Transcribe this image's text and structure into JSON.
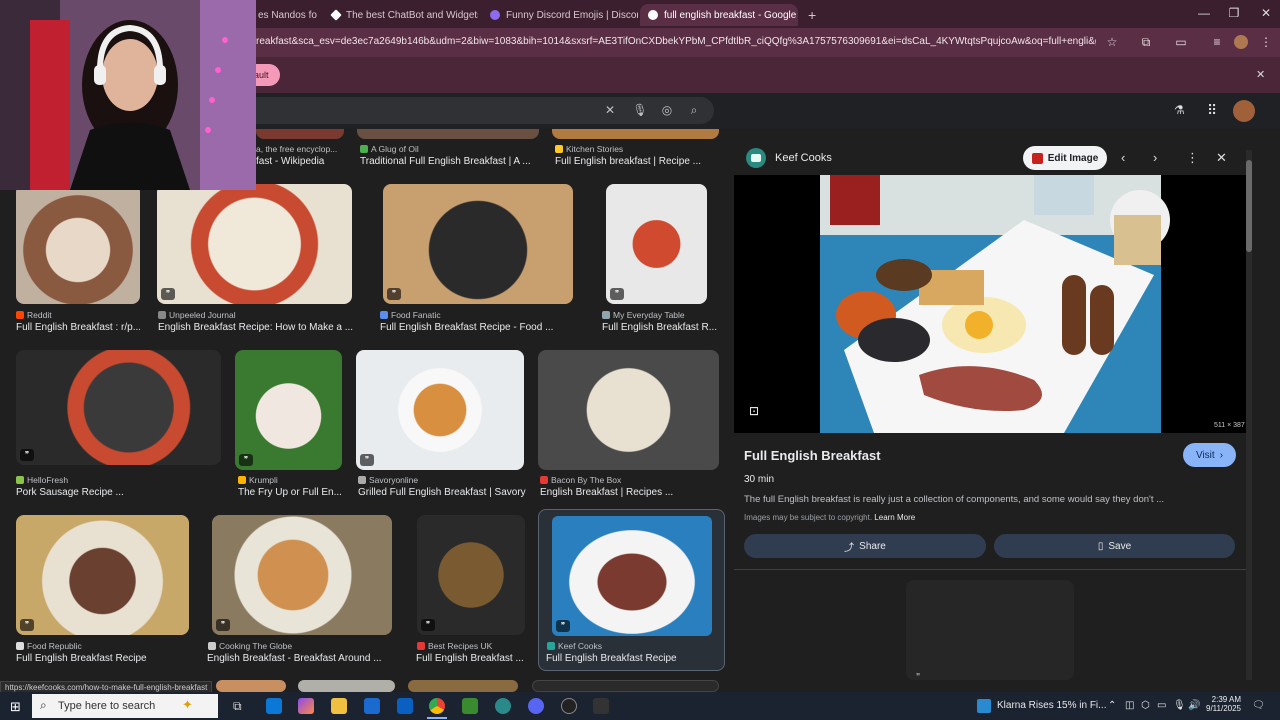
{
  "tabs": [
    {
      "label": "es Nandos fo",
      "color": "#e07a3a"
    },
    {
      "label": "The best ChatBot and Widgets",
      "color": "#ffffff"
    },
    {
      "label": "Funny Discord Emojis | Discord",
      "color": "#8b6cf0"
    },
    {
      "label": "full english breakfast - Google S",
      "color": "#ffffff"
    }
  ],
  "new_tab": "+",
  "address_url": "reakfast&sca_esv=de3ec7a2649b146b&udm=2&biw=1083&bih=1014&sxsrf=AE3TifOnCXDbekYPbM_CPfdtlbR_ciQQfg%3A1757576309691&ei=dsCaL_4KYWtqtsPqujcoAw&oq=full+engli&gs_lp=EgNp...",
  "default_chip": "ault",
  "status_url": "https://keefcooks.com/how-to-make-full-english-breakfast",
  "grid": {
    "row0": [
      {
        "source": "a, the free encyclop...",
        "title": "fast - Wikipedia",
        "color": "#4a90e2"
      },
      {
        "source": "A Glug of Oil",
        "title": "Traditional Full English Breakfast | A ...",
        "color": "#4caf50"
      },
      {
        "source": "Kitchen Stories",
        "title": "Full English breakfast | Recipe ...",
        "color": "#ffca28"
      }
    ],
    "row1": [
      {
        "source": "Reddit",
        "title": "Full English Breakfast : r/p...",
        "color": "#ff4500"
      },
      {
        "source": "Unpeeled Journal",
        "title": "English Breakfast Recipe: How to Make a ...",
        "color": "#888888"
      },
      {
        "source": "Food Fanatic",
        "title": "Full English Breakfast Recipe - Food ...",
        "color": "#5b8def"
      },
      {
        "source": "My Everyday Table",
        "title": "Full English Breakfast R...",
        "color": "#90a4ae"
      }
    ],
    "row2": [
      {
        "source": "HelloFresh",
        "title": "Pork Sausage Recipe ...",
        "color": "#8bc34a"
      },
      {
        "source": "Krumpli",
        "title": "The Fry Up or Full En...",
        "color": "#ffb300"
      },
      {
        "source": "Savoryonline",
        "title": "Grilled Full English Breakfast | Savory",
        "color": "#aaaaaa"
      },
      {
        "source": "Bacon By The Box",
        "title": "English Breakfast | Recipes ...",
        "color": "#e53935"
      }
    ],
    "row3": [
      {
        "source": "Food Republic",
        "title": "Full English Breakfast Recipe",
        "color": "#dddddd"
      },
      {
        "source": "Cooking The Globe",
        "title": "English Breakfast - Breakfast Around ...",
        "color": "#cccccc"
      },
      {
        "source": "Best Recipes UK",
        "title": "Full English Breakfast ...",
        "color": "#e53935"
      },
      {
        "source": "Keef Cooks",
        "title": "Full English Breakfast Recipe",
        "color": "#26a69a"
      }
    ]
  },
  "panel": {
    "site": "Keef Cooks",
    "edit_image": "Edit Image",
    "dimensions": "511 × 387",
    "title": "Full English Breakfast",
    "visit": "Visit",
    "time": "30 min",
    "description": "The full English breakfast is really just a collection of components, and some would say they don't ...",
    "copyright": "Images may be subject to copyright.",
    "learn_more": "Learn More",
    "share": "Share",
    "save": "Save"
  },
  "taskbar": {
    "search_placeholder": "Type here to search",
    "news": "Klarna Rises 15% in Fi...",
    "time": "2:39 AM",
    "date": "9/11/2025"
  }
}
